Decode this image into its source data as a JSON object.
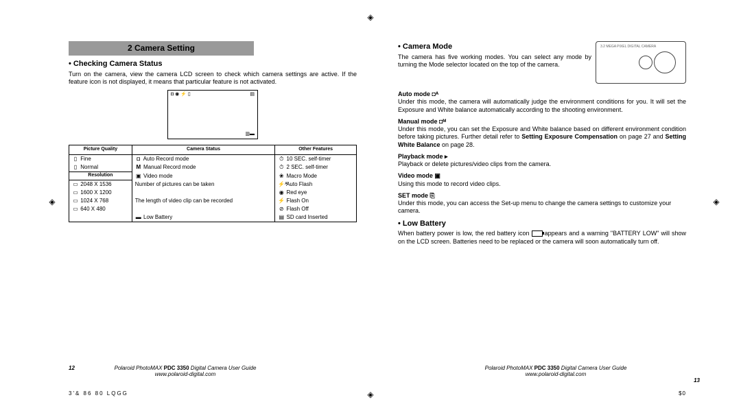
{
  "section_title": "2 Camera Setting",
  "left": {
    "h1": "Checking Camera Status",
    "p1": "Turn on the camera, view the camera LCD screen to check which camera settings are active. If the feature icon is not displayed, it means that particular feature is not activated.",
    "table": {
      "headers": [
        "Picture Quality",
        "Camera Status",
        "Other Features"
      ],
      "pq_sub": "Resolution",
      "pq": [
        {
          "icon": "▯",
          "label": "Fine"
        },
        {
          "icon": "▯",
          "label": "Normal"
        }
      ],
      "res": [
        {
          "icon": "▭",
          "label": "2048 X 1536"
        },
        {
          "icon": "▭",
          "label": "1600 X 1200"
        },
        {
          "icon": "▭",
          "label": "1024 X 768"
        },
        {
          "icon": "▭",
          "label": "640 X 480"
        }
      ],
      "cs": [
        {
          "icon": "◘",
          "label": "Auto Record mode"
        },
        {
          "icon": "M",
          "label": "Manual Record mode"
        },
        {
          "icon": "▣",
          "label": "Video mode"
        },
        {
          "icon": " ",
          "label": "Number of pictures can be taken"
        },
        {
          "icon": " ",
          "label": "The length of video clip can be recorded"
        },
        {
          "icon": "▬",
          "label": "Low Battery"
        }
      ],
      "of": [
        {
          "icon": "⏱",
          "label": "10 SEC. self-timer"
        },
        {
          "icon": "⏱",
          "label": "2 SEC. self-timer"
        },
        {
          "icon": "❀",
          "label": "Macro Mode"
        },
        {
          "icon": "⚡ᴬ",
          "label": "Auto Flash"
        },
        {
          "icon": "◉",
          "label": "Red eye"
        },
        {
          "icon": "⚡",
          "label": "Flash On"
        },
        {
          "icon": "⊘",
          "label": "Flash Off"
        },
        {
          "icon": "▤",
          "label": "SD card Inserted"
        }
      ]
    }
  },
  "right": {
    "h1": "Camera Mode",
    "p1": "The camera has five working modes. You can select any mode by turning the Mode selector located on the top of the camera.",
    "camera_label": "3.2 MEGA PIXEL DIGITAL CAMERA",
    "modes": [
      {
        "title": "Auto mode ◘ᴬ",
        "body": "Under this mode, the camera will automatically judge the environment conditions for you. It will set the Exposure and White balance automatically according to the shooting environment."
      },
      {
        "title": "Manual mode ◘ᴹ",
        "body_pre": "Under this mode, you can set the Exposure and White balance based on different environment condition before taking pictures. Further detail refer to ",
        "bold1": "Setting Exposure Compensation",
        "mid": " on page 27 and ",
        "bold2": "Setting White Balance",
        "post": " on page 28."
      },
      {
        "title": "Playback mode ▸",
        "body": "Playback or delete pictures/video clips from the camera."
      },
      {
        "title": "Video mode ▣",
        "body": "Using this mode to record video clips."
      },
      {
        "title": "SET mode ⎘",
        "body": "Under this mode, you can access the Set-up menu to change the camera settings to customize your camera."
      }
    ],
    "low_h": "Low Battery",
    "low_p_pre": "When battery power is low, the red battery icon ",
    "low_p_post": " appears and a warning \"BATTERY LOW\" will show on the LCD screen. Batteries need to be replaced or the camera will soon automatically turn off."
  },
  "footer": {
    "page_left": "12",
    "page_right": "13",
    "guide_pre": "Polaroid PhotoMAX ",
    "guide_bold": "PDC 3350",
    "guide_post": " Digital Camera User Guide",
    "url": "www.polaroid-digital.com"
  },
  "codes": {
    "left": "3'& 86 80 LQGG",
    "right": "$0"
  }
}
